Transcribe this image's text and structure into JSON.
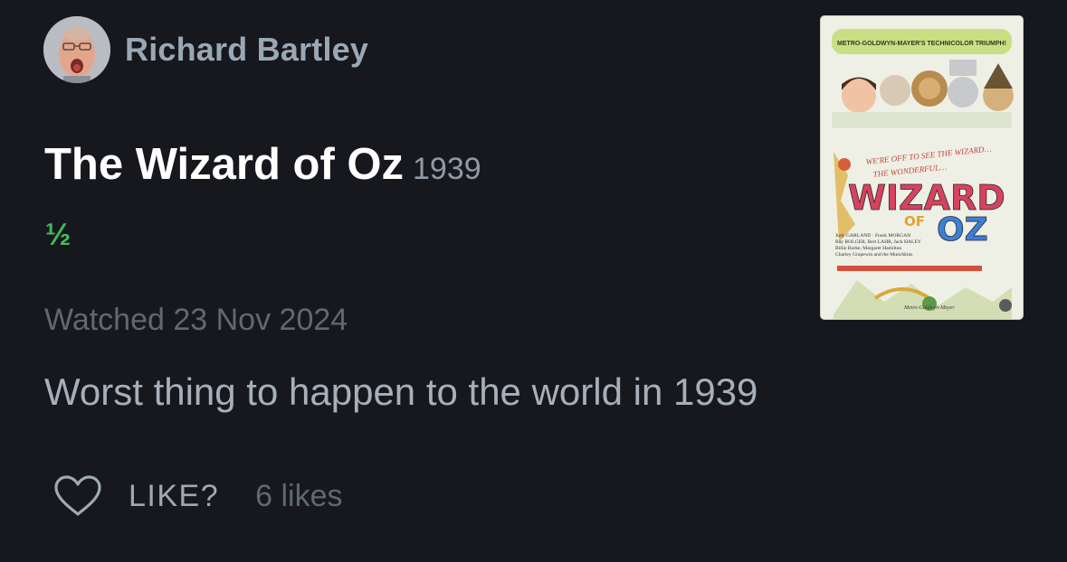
{
  "review": {
    "author_name": "Richard Bartley",
    "film_title": "The Wizard of Oz",
    "film_year": "1939",
    "rating_text": "½",
    "watched_text": "Watched 23 Nov 2024",
    "review_text": "Worst thing to happen to the world in 1939",
    "like_label": "LIKE?",
    "likes_count_text": "6 likes"
  },
  "poster": {
    "banner_text": "METRO-GOLDWYN-MAYER'S TECHNICOLOR TRIUMPH!",
    "tagline_line1": "WE'RE OFF TO SEE THE WIZARD…",
    "tagline_line2": "THE WONDERFUL…",
    "title_word1": "WIZARD",
    "title_word2": "OF",
    "title_word3": "OZ",
    "credits_line1": "Judy GARLAND · Frank MORGAN",
    "credits_line2": "Ray BOLGER, Bert LAHR, Jack HALEY",
    "credits_line3": "Billie Burke, Margaret Hamilton",
    "credits_line4": "Charley Grapewin and the Munchkins",
    "studio_text": "Metro-Goldwyn-Mayer"
  },
  "colors": {
    "background": "#16181d",
    "author": "#9aa7b5",
    "title": "#ffffff",
    "rating_green": "#40bc5c",
    "muted": "#5f6873",
    "review_text": "#a7b0ba"
  },
  "icons": {
    "like": "heart-outline-icon",
    "avatar": "user-avatar"
  }
}
